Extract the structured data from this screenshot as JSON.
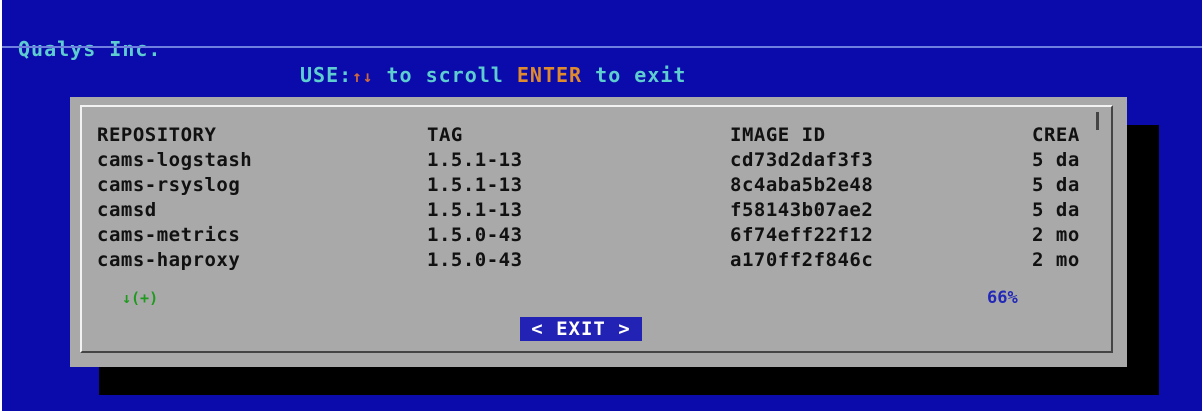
{
  "header": {
    "brand": "Qualys Inc.",
    "hint_prefix": "USE:",
    "hint_arrows": "↑↓",
    "hint_middle": " to scroll ",
    "hint_enter": "ENTER",
    "hint_suffix": " to exit"
  },
  "table": {
    "headers": [
      "REPOSITORY",
      "TAG",
      "IMAGE ID",
      "CREA"
    ],
    "rows": [
      [
        "cams-logstash",
        "1.5.1-13",
        "cd73d2daf3f3",
        "5 da"
      ],
      [
        "cams-rsyslog",
        "1.5.1-13",
        "8c4aba5b2e48",
        "5 da"
      ],
      [
        "camsd",
        "1.5.1-13",
        "f58143b07ae2",
        "5 da"
      ],
      [
        "cams-metrics",
        "1.5.0-43",
        "6f74eff22f12",
        "2 mo"
      ],
      [
        "cams-haproxy",
        "1.5.0-43",
        "a170ff2f846c",
        "2 mo"
      ]
    ]
  },
  "scroll": {
    "more_indicator": "↓(+)",
    "percent": "66%"
  },
  "buttons": {
    "exit_label": "< EXIT >"
  },
  "colors": {
    "background": "#0b0bab",
    "dialog": "#a9a9a9",
    "highlight": "#2222b4",
    "header_text": "#5ecdd0",
    "accent": "#e08a2e"
  }
}
